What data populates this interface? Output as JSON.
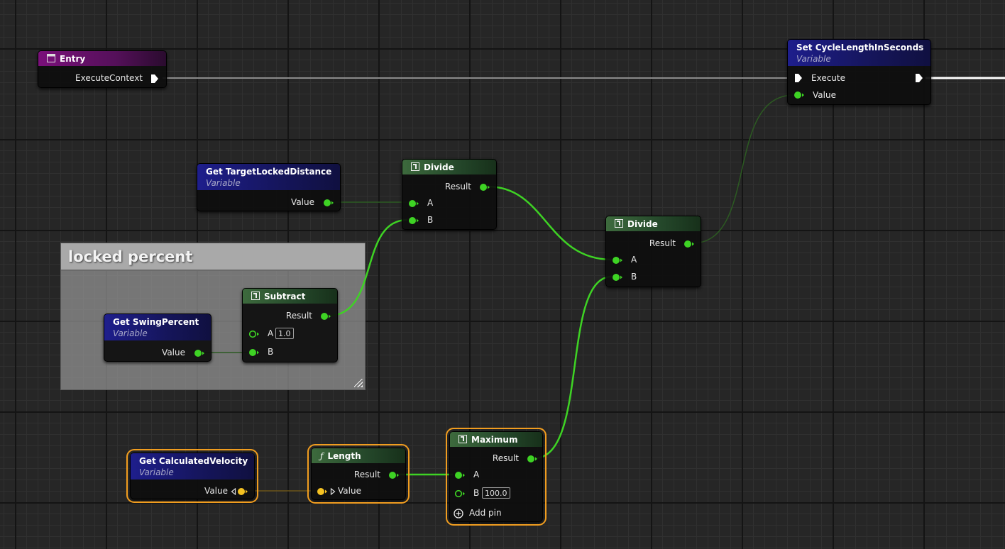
{
  "comment": {
    "title": "locked percent"
  },
  "nodes": {
    "entry": {
      "title": "Entry",
      "pin_execute_context": "ExecuteContext"
    },
    "set_cycle": {
      "title": "Set CycleLengthInSeconds",
      "subtitle": "Variable",
      "pin_execute": "Execute",
      "pin_value": "Value"
    },
    "get_target_locked": {
      "title": "Get TargetLockedDistance",
      "subtitle": "Variable",
      "pin_value": "Value"
    },
    "divide1": {
      "title": "Divide",
      "pin_result": "Result",
      "pin_a": "A",
      "pin_b": "B"
    },
    "divide2": {
      "title": "Divide",
      "pin_result": "Result",
      "pin_a": "A",
      "pin_b": "B"
    },
    "get_swing": {
      "title": "Get SwingPercent",
      "subtitle": "Variable",
      "pin_value": "Value"
    },
    "subtract": {
      "title": "Subtract",
      "pin_result": "Result",
      "pin_a": "A",
      "a_default": "1.0",
      "pin_b": "B"
    },
    "get_velocity": {
      "title": "Get CalculatedVelocity",
      "subtitle": "Variable",
      "pin_value": "Value"
    },
    "length": {
      "title": "Length",
      "pin_result": "Result",
      "pin_value": "Value"
    },
    "maximum": {
      "title": "Maximum",
      "pin_result": "Result",
      "pin_a": "A",
      "pin_b": "B",
      "b_default": "100.0",
      "add_pin": "Add pin"
    }
  },
  "colors": {
    "float_pin": "#3ed324",
    "struct_pin": "#f5c222",
    "exec_pin": "#ffffff",
    "selection": "#f19d1f",
    "variable_header": "#1e1e8c",
    "event_header": "#7a107a",
    "function_header": "#3d6a3d"
  },
  "icons": {
    "entry": "event-icon",
    "function": "function-icon",
    "length": "f-function-icon",
    "add_pin": "plus-circle-icon"
  }
}
